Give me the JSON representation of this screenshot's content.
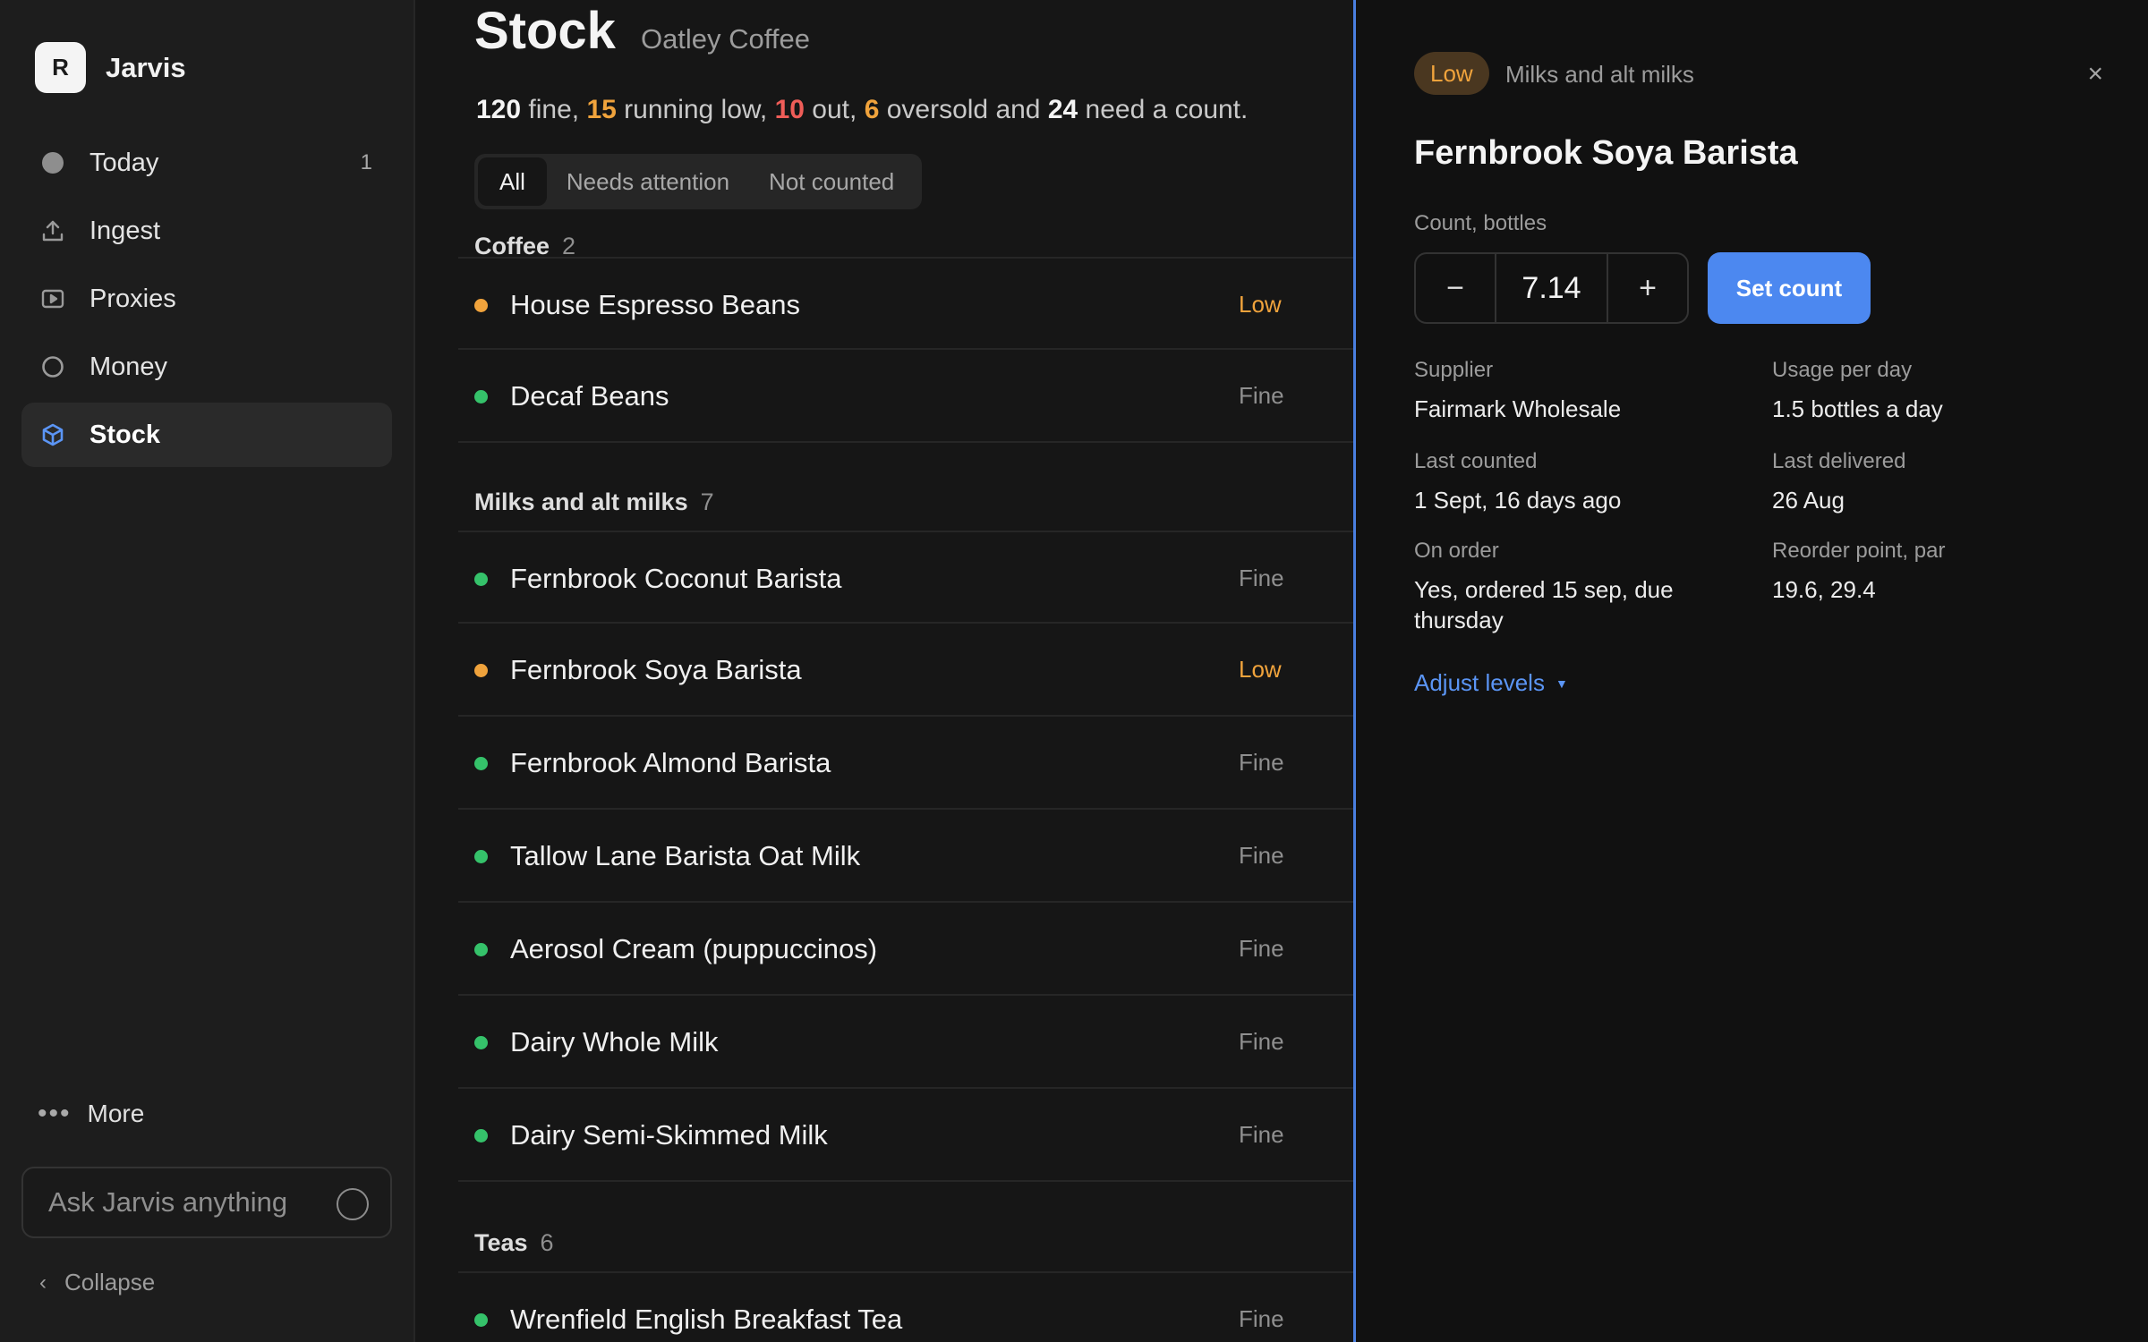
{
  "app": {
    "logo_letter": "R",
    "name": "Jarvis"
  },
  "sidebar": {
    "items": [
      {
        "label": "Today",
        "count": "1",
        "icon": "circle-filled-icon"
      },
      {
        "label": "Ingest",
        "count": "",
        "icon": "upload-icon"
      },
      {
        "label": "Proxies",
        "count": "",
        "icon": "play-window-icon"
      },
      {
        "label": "Money",
        "count": "",
        "icon": "circle-outline-icon"
      },
      {
        "label": "Stock",
        "count": "",
        "icon": "cube-icon",
        "active": true
      }
    ],
    "more_label": "More",
    "ask_placeholder": "Ask Jarvis anything",
    "collapse_label": "Collapse"
  },
  "main": {
    "title": "Stock",
    "subtitle": "Oatley Coffee",
    "summary": {
      "fine_count": "120",
      "fine_text": " fine, ",
      "low_count": "15",
      "low_text": " running low, ",
      "out_count": "10",
      "out_text": " out, ",
      "oversold_count": "6",
      "oversold_text": " oversold and ",
      "count_count": "24",
      "count_text": " need a count."
    },
    "tabs": [
      {
        "label": "All",
        "active": true
      },
      {
        "label": "Needs attention"
      },
      {
        "label": "Not counted"
      }
    ],
    "groups": [
      {
        "name": "Coffee",
        "count": "2",
        "items": [
          {
            "name": "House Espresso Beans",
            "status": "Low"
          },
          {
            "name": "Decaf Beans",
            "status": "Fine"
          }
        ]
      },
      {
        "name": "Milks and alt milks",
        "count": "7",
        "items": [
          {
            "name": "Fernbrook Coconut Barista",
            "status": "Fine"
          },
          {
            "name": "Fernbrook Soya Barista",
            "status": "Low"
          },
          {
            "name": "Fernbrook Almond Barista",
            "status": "Fine"
          },
          {
            "name": "Tallow Lane Barista Oat Milk",
            "status": "Fine"
          },
          {
            "name": "Aerosol Cream (puppuccinos)",
            "status": "Fine"
          },
          {
            "name": "Dairy Whole Milk",
            "status": "Fine"
          },
          {
            "name": "Dairy Semi-Skimmed Milk",
            "status": "Fine"
          }
        ]
      },
      {
        "name": "Teas",
        "count": "6",
        "items": [
          {
            "name": "Wrenfield English Breakfast Tea",
            "status": "Fine"
          }
        ]
      }
    ]
  },
  "detail": {
    "badge": "Low",
    "category": "Milks and alt milks",
    "close_symbol": "×",
    "title": "Fernbrook Soya Barista",
    "count_label": "Count, bottles",
    "count_value": "7.14",
    "minus_symbol": "−",
    "plus_symbol": "+",
    "set_count_label": "Set count",
    "fields": {
      "supplier": {
        "label": "Supplier",
        "value": "Fairmark Wholesale"
      },
      "usage": {
        "label": "Usage per day",
        "value": "1.5 bottles a day"
      },
      "last_counted": {
        "label": "Last counted",
        "value": "1 Sept, 16 days ago"
      },
      "last_delivered": {
        "label": "Last delivered",
        "value": "26 Aug"
      },
      "on_order": {
        "label": "On order",
        "value": "Yes, ordered 15 sep, due thursday"
      },
      "reorder": {
        "label": "Reorder point, par",
        "value": "19.6, 29.4"
      }
    },
    "adjust_label": "Adjust levels"
  },
  "colors": {
    "fine": "#35c26a",
    "low": "#f0a33c",
    "out": "#ef5d58",
    "accent": "#4c88f0"
  }
}
